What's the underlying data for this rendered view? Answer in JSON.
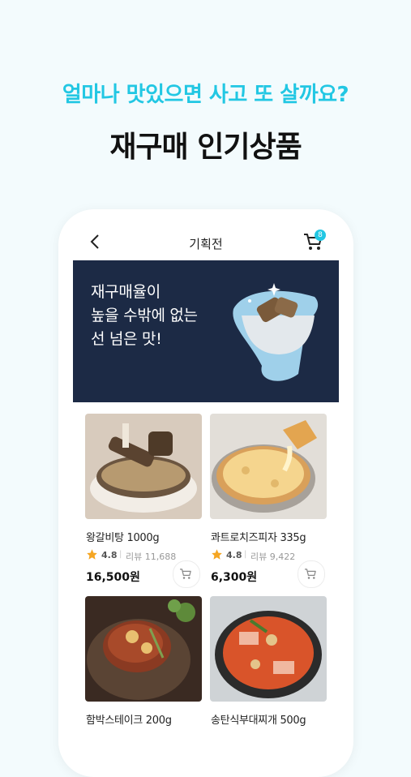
{
  "headline": "얼마나 맛있으면 사고 또 살까요?",
  "title": "재구매 인기상품",
  "appbar": {
    "title": "기획전",
    "cart_count": "8"
  },
  "banner": {
    "lines": [
      "재구매율이",
      "높을 수밖에 없는",
      "선 넘은 맛!"
    ]
  },
  "products": [
    {
      "name": "왕갈비탕 1000g",
      "rating": "4.8",
      "reviews": "리뷰 11,688",
      "price": "16,500원"
    },
    {
      "name": "콰트로치즈피자 335g",
      "rating": "4.8",
      "reviews": "리뷰 9,422",
      "price": "6,300원"
    },
    {
      "name": "함박스테이크 200g"
    },
    {
      "name": "송탄식부대찌개 500g"
    }
  ],
  "colors": {
    "accent": "#22c7e3",
    "banner_bg": "#1c2a45",
    "star": "#f5a623"
  },
  "icons": [
    "back-arrow-icon",
    "cart-icon",
    "star-icon",
    "add-to-cart-icon"
  ]
}
